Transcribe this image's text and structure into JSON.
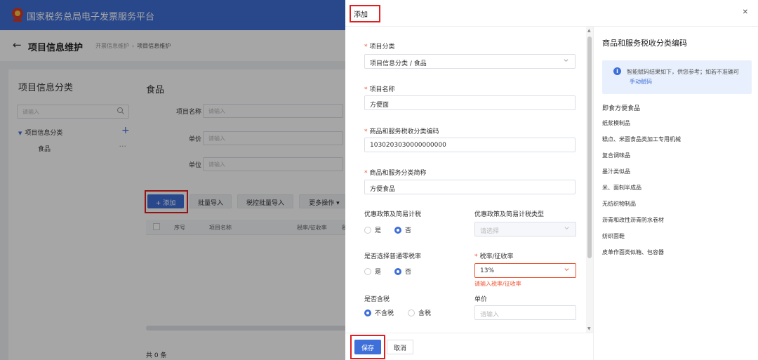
{
  "colors": {
    "primary": "#3f6fd8",
    "danger": "#e53333",
    "highlight_box": "#e02020"
  },
  "bg": {
    "platform_title": "国家税务总局电子发票服务平台",
    "page_title": "项目信息维护",
    "breadcrumb": [
      "开票信息维护",
      "项目信息维护"
    ],
    "left_panel": {
      "title": "项目信息分类",
      "search_placeholder": "请输入",
      "tree_root": "项目信息分类",
      "tree_child": "食品"
    },
    "main_panel": {
      "title": "食品",
      "filters": [
        {
          "label": "项目名称",
          "placeholder": "请输入"
        },
        {
          "label": "单价",
          "placeholder": "请输入"
        },
        {
          "label": "单位",
          "placeholder": "请输入"
        }
      ],
      "buttons": {
        "add": "添加",
        "batch_import": "批量导入",
        "tax_batch_import": "税控批量导入",
        "more": "更多操作"
      },
      "table_headers": [
        "序号",
        "项目名称",
        "税率/征收率",
        "税"
      ],
      "total": "共 0 条"
    }
  },
  "drawer": {
    "title": "添加",
    "close_icon": "close-icon",
    "form": {
      "category": {
        "label": "项目分类",
        "value": "项目信息分类 / 食品"
      },
      "name": {
        "label": "项目名称",
        "value": "方便面"
      },
      "tax_code": {
        "label": "商品和服务税收分类编码",
        "value": "1030203030000000000"
      },
      "tax_short_name": {
        "label": "商品和服务分类简称",
        "value": "方便食品"
      },
      "preferential": {
        "label": "优惠政策及简易计税",
        "options": [
          "是",
          "否"
        ],
        "selected": "否"
      },
      "preferential_type": {
        "label": "优惠政策及简易计税类型",
        "placeholder": "请选择"
      },
      "zero_rate": {
        "label": "是否选择普通零税率",
        "options": [
          "是",
          "否"
        ],
        "selected": "否"
      },
      "tax_rate": {
        "label": "税率/征收率",
        "value": "13%",
        "error": "请输入税率/征收率"
      },
      "tax_included": {
        "label": "是否含税",
        "options": [
          "不含税",
          "含税"
        ],
        "selected": "不含税"
      },
      "unit_price": {
        "label": "单价",
        "placeholder": "请输入"
      }
    },
    "footer": {
      "save": "保存",
      "cancel": "取消"
    },
    "code_panel": {
      "title": "商品和服务税收分类编码",
      "tip_text": "智能赋码结果如下，供您参考；如若不准确可",
      "tip_link": "手动赋码",
      "items": [
        "即食方便食品",
        "纸浆模制品",
        "糕点、米面食品类加工专用机械",
        "复合调味品",
        "墨汁类似品",
        "米、面制半成品",
        "无纺织物制品",
        "沥青和改性沥青防水卷材",
        "纺织面鞋",
        "皮革作面类似箱、包容器"
      ]
    }
  }
}
